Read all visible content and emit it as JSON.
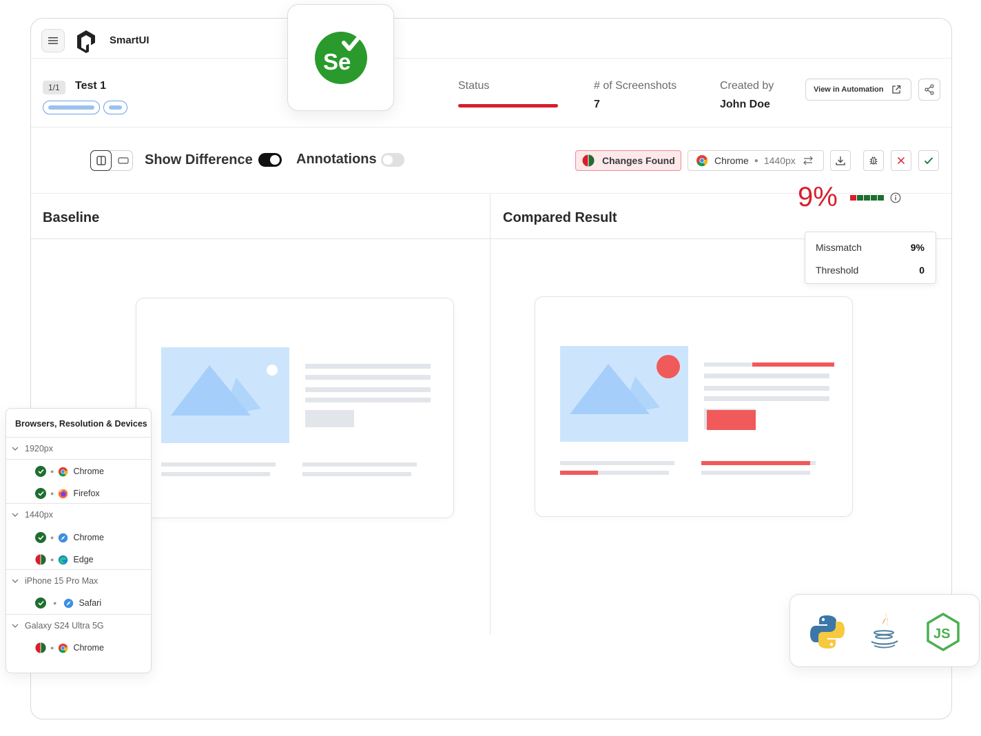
{
  "app": {
    "name": "SmartUI"
  },
  "header": {
    "count_badge": "1/1",
    "test_name": "Test 1",
    "status_label": "Status",
    "screenshots_label": "# of Screenshots",
    "screenshots_value": "7",
    "created_label": "Created by",
    "created_value": "John Doe",
    "automation_button": "View in Automation"
  },
  "toolbar": {
    "show_difference_label": "Show Difference",
    "show_difference_on": true,
    "annotations_label": "Annotations",
    "annotations_on": false,
    "changes_badge": "Changes Found",
    "browser": "Chrome",
    "resolution": "1440px"
  },
  "panels": {
    "baseline_title": "Baseline",
    "compared_title": "Compared Result",
    "mismatch_percent": "9%"
  },
  "tooltip": {
    "mismatch_label": "Missmatch",
    "mismatch_value": "9%",
    "threshold_label": "Threshold",
    "threshold_value": "0"
  },
  "devices": {
    "title": "Browsers, Resolution & Devices",
    "groups": [
      {
        "name": "1920px",
        "items": [
          {
            "browser": "Chrome",
            "status": "passed"
          },
          {
            "browser": "Firefox",
            "status": "passed"
          }
        ]
      },
      {
        "name": "1440px",
        "items": [
          {
            "browser": "Chrome",
            "status": "passed"
          },
          {
            "browser": "Edge",
            "status": "changes"
          }
        ]
      },
      {
        "name": "iPhone 15 Pro Max",
        "items": [
          {
            "browser": "Safari",
            "status": "passed"
          }
        ]
      },
      {
        "name": "Galaxy S24 Ultra 5G",
        "items": [
          {
            "browser": "Chrome",
            "status": "changes"
          }
        ]
      }
    ]
  },
  "languages": [
    "python-icon",
    "java-icon",
    "nodejs-icon"
  ],
  "colors": {
    "accent_red": "#d81e2c",
    "pass_green": "#1e6e2f",
    "selenium_green": "#2a9a2c"
  }
}
